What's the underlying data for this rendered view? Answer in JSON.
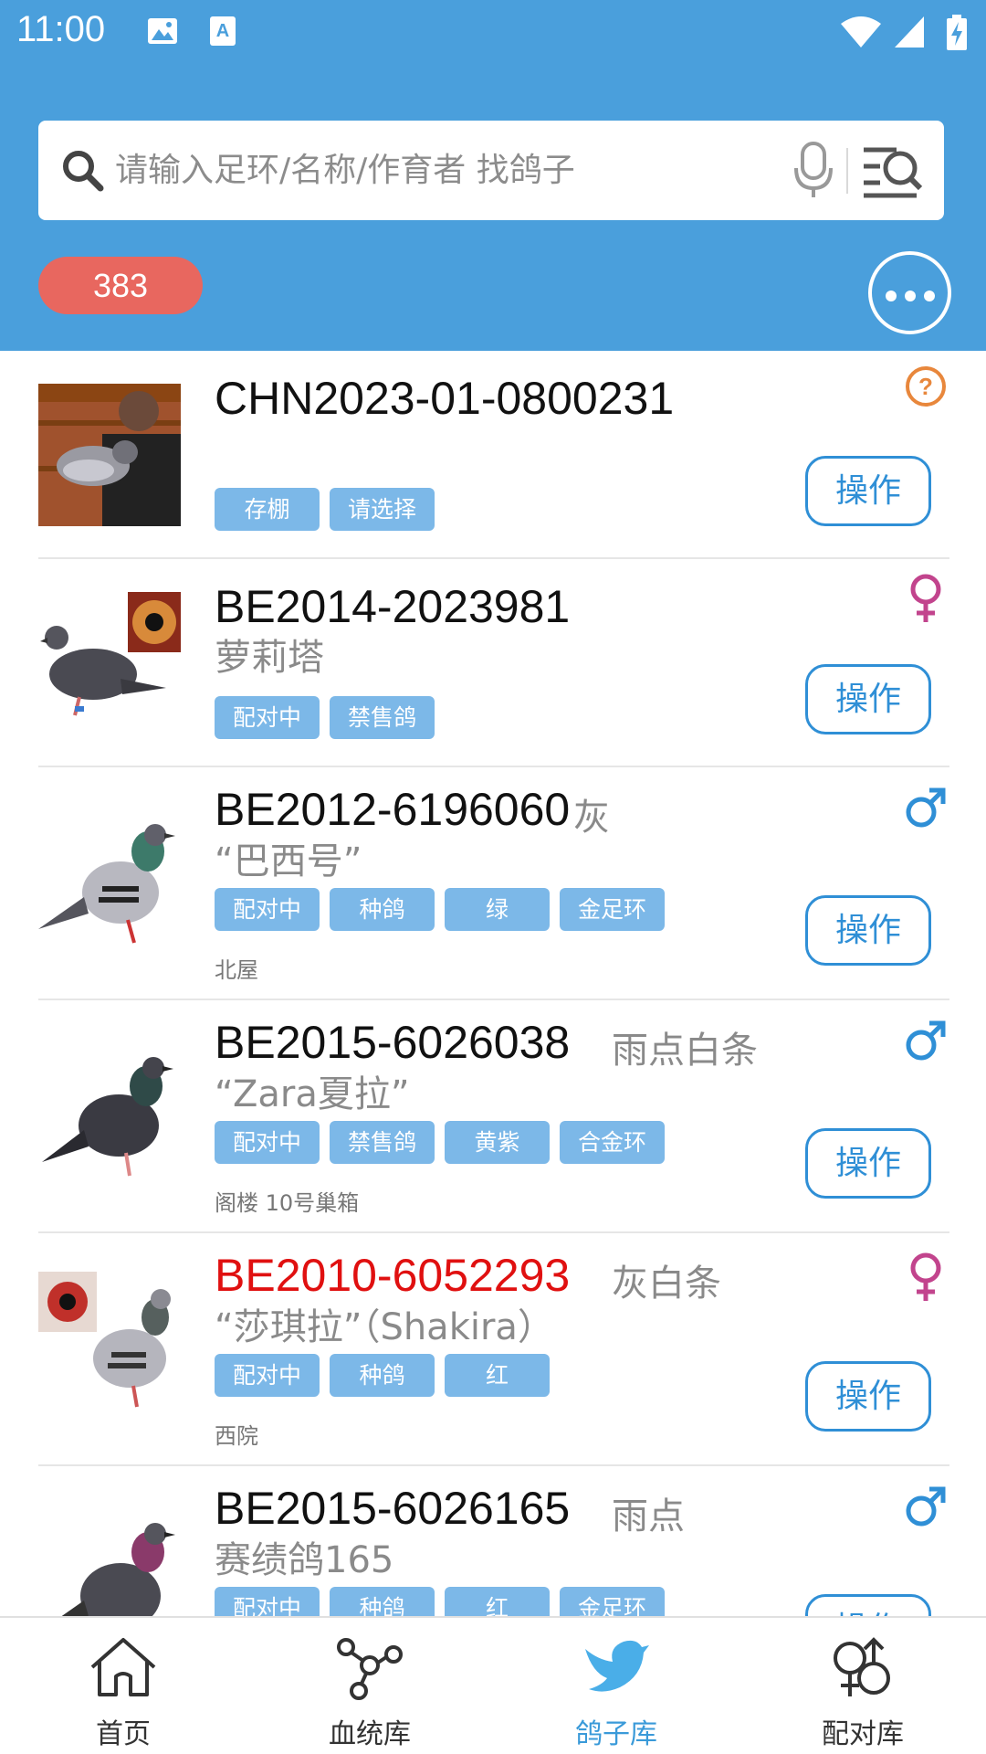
{
  "status_bar": {
    "time": "11:00",
    "icons": [
      "image-icon",
      "a-text-icon",
      "wifi-icon",
      "signal-icon",
      "battery-charging-icon"
    ]
  },
  "search": {
    "placeholder": "请输入足环/名称/作育者 找鸽子",
    "icons": [
      "search-icon",
      "mic-icon",
      "advanced-search-icon"
    ]
  },
  "count_badge": "383",
  "colors": {
    "header": "#4a9fdc",
    "badge": "#e8675f",
    "tag": "#7cb8e8",
    "button": "#2f8fd6",
    "female": "#c2448d",
    "male": "#2f8fd6",
    "unknown": "#e8873c",
    "red_ring": "#e01010"
  },
  "list": [
    {
      "ring": "CHN2023-01-0800231",
      "ring_red": false,
      "color": "",
      "name": "",
      "tags": [
        "存棚",
        "请选择"
      ],
      "loft": "",
      "sex": "unknown",
      "action": "操作"
    },
    {
      "ring": "BE2014-2023981",
      "ring_red": false,
      "color": "",
      "name": "萝莉塔",
      "tags": [
        "配对中",
        "禁售鸽"
      ],
      "loft": "",
      "sex": "female",
      "action": "操作"
    },
    {
      "ring": "BE2012-6196060",
      "ring_red": false,
      "color": "灰",
      "name": "“巴西号”",
      "tags": [
        "配对中",
        "种鸽",
        "绿",
        "金足环"
      ],
      "loft": "北屋",
      "sex": "male",
      "action": "操作"
    },
    {
      "ring": "BE2015-6026038",
      "ring_red": false,
      "color": "雨点白条",
      "name": "“Zara夏拉”",
      "tags": [
        "配对中",
        "禁售鸽",
        "黄紫",
        "合金环"
      ],
      "loft": "阁楼  10号巢箱",
      "sex": "male",
      "action": "操作"
    },
    {
      "ring": "BE2010-6052293",
      "ring_red": true,
      "color": "灰白条",
      "name": "“莎琪拉”（Shakira）",
      "tags": [
        "配对中",
        "种鸽",
        "红"
      ],
      "loft": "西院",
      "sex": "female",
      "action": "操作"
    },
    {
      "ring": "BE2015-6026165",
      "ring_red": false,
      "color": "雨点",
      "name": "赛绩鸽165",
      "tags": [
        "配对中",
        "种鸽",
        "红",
        "金足环"
      ],
      "loft": "",
      "sex": "male",
      "action": "操作"
    }
  ],
  "nav": [
    {
      "label": "首页",
      "icon": "home-icon",
      "active": false
    },
    {
      "label": "血统库",
      "icon": "pedigree-icon",
      "active": false
    },
    {
      "label": "鸽子库",
      "icon": "bird-icon",
      "active": true
    },
    {
      "label": "配对库",
      "icon": "pairing-icon",
      "active": false
    }
  ]
}
